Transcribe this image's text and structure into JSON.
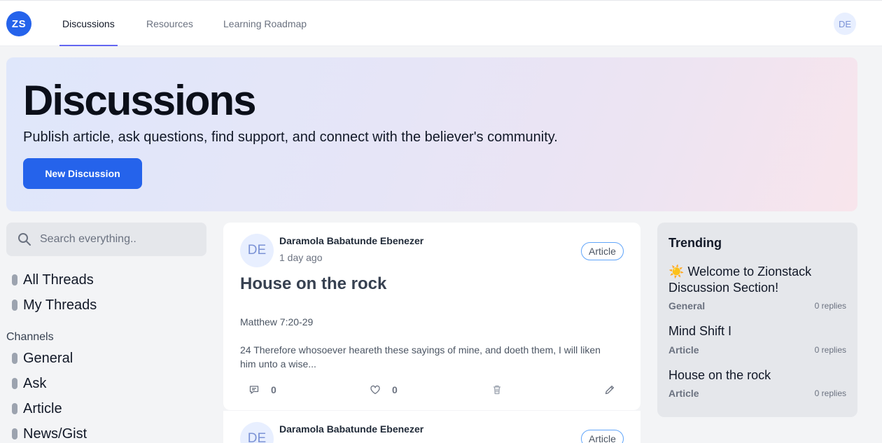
{
  "header": {
    "logo_text": "ZS",
    "tabs": [
      {
        "label": "Discussions",
        "active": true
      },
      {
        "label": "Resources",
        "active": false
      },
      {
        "label": "Learning Roadmap",
        "active": false
      }
    ],
    "user_initials": "DE"
  },
  "hero": {
    "title": "Discussions",
    "subtitle": "Publish article, ask questions, find support, and connect with the believer's community.",
    "button_label": "New Discussion"
  },
  "sidebar": {
    "search_placeholder": "Search everything..",
    "threads": [
      "All Threads",
      "My Threads"
    ],
    "channels_label": "Channels",
    "channels": [
      "General",
      "Ask",
      "Article",
      "News/Gist"
    ]
  },
  "feed": [
    {
      "initials": "DE",
      "author": "Daramola Babatunde Ebenezer",
      "time": "1 day ago",
      "tag": "Article",
      "title": "House on the rock",
      "reference": "Matthew 7:20-29",
      "body": "24 Therefore whosoever heareth these sayings of mine, and doeth them, I will liken him unto a wise...",
      "comments": "0",
      "likes": "0"
    },
    {
      "initials": "DE",
      "author": "Daramola Babatunde Ebenezer",
      "tag": "Article"
    }
  ],
  "trending": {
    "heading": "Trending",
    "items": [
      {
        "emoji": "☀️",
        "title": "Welcome to Zionstack Discussion Section!",
        "channel": "General",
        "replies": "0 replies"
      },
      {
        "title": "Mind Shift I",
        "channel": "Article",
        "replies": "0 replies"
      },
      {
        "title": "House on the rock",
        "channel": "Article",
        "replies": "0 replies"
      }
    ]
  },
  "colors": {
    "primary": "#2563eb",
    "tab_indicator": "#6366f1",
    "tag_border": "#60a5fa"
  }
}
